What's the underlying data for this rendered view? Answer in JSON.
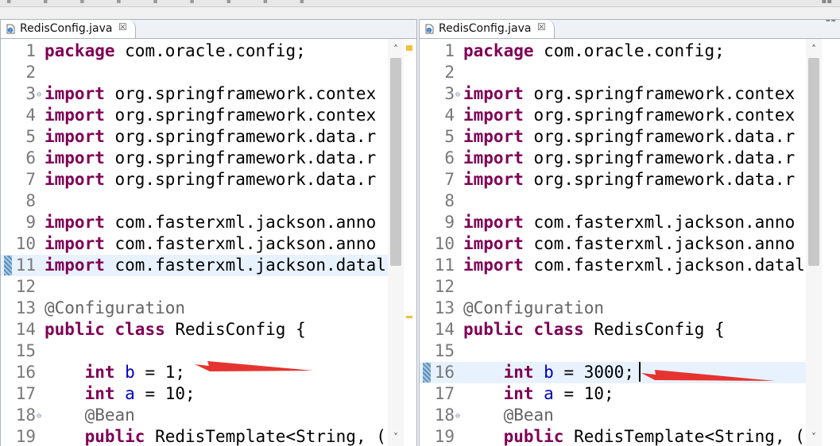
{
  "editors": [
    {
      "tab": {
        "label": "RedisConfig.java",
        "close_glyph": "☒"
      },
      "lines": [
        {
          "n": "1",
          "parts": [
            {
              "t": "package",
              "k": "kw"
            },
            {
              "t": " com.oracle.config;"
            }
          ]
        },
        {
          "n": "2",
          "parts": []
        },
        {
          "n": "3",
          "fold": true,
          "parts": [
            {
              "t": "import",
              "k": "kw"
            },
            {
              "t": " org.springframework.contex"
            }
          ]
        },
        {
          "n": "4",
          "parts": [
            {
              "t": "import",
              "k": "kw"
            },
            {
              "t": " org.springframework.contex"
            }
          ]
        },
        {
          "n": "5",
          "parts": [
            {
              "t": "import",
              "k": "kw"
            },
            {
              "t": " org.springframework.data.r"
            }
          ]
        },
        {
          "n": "6",
          "parts": [
            {
              "t": "import",
              "k": "kw"
            },
            {
              "t": " org.springframework.data.r"
            }
          ]
        },
        {
          "n": "7",
          "parts": [
            {
              "t": "import",
              "k": "kw"
            },
            {
              "t": " org.springframework.data.r"
            }
          ]
        },
        {
          "n": "8",
          "parts": []
        },
        {
          "n": "9",
          "parts": [
            {
              "t": "import",
              "k": "kw"
            },
            {
              "t": " com.fasterxml.jackson.anno"
            }
          ]
        },
        {
          "n": "10",
          "parts": [
            {
              "t": "import",
              "k": "kw"
            },
            {
              "t": " com.fasterxml.jackson.anno"
            }
          ]
        },
        {
          "n": "11",
          "hl": true,
          "marker": true,
          "parts": [
            {
              "t": "import",
              "k": "kw"
            },
            {
              "t": " com.fasterxml.jackson.datal"
            }
          ]
        },
        {
          "n": "12",
          "parts": []
        },
        {
          "n": "13",
          "parts": [
            {
              "t": "@Configuration",
              "k": "ann"
            }
          ]
        },
        {
          "n": "14",
          "parts": [
            {
              "t": "public",
              "k": "kw"
            },
            {
              "t": " "
            },
            {
              "t": "class",
              "k": "kw"
            },
            {
              "t": " RedisConfig {"
            }
          ]
        },
        {
          "n": "15",
          "parts": []
        },
        {
          "n": "16",
          "parts": [
            {
              "t": "    "
            },
            {
              "t": "int",
              "k": "kw"
            },
            {
              "t": " "
            },
            {
              "t": "b",
              "k": "fld"
            },
            {
              "t": " = 1;"
            }
          ]
        },
        {
          "n": "17",
          "parts": [
            {
              "t": "    "
            },
            {
              "t": "int",
              "k": "kw"
            },
            {
              "t": " "
            },
            {
              "t": "a",
              "k": "fld"
            },
            {
              "t": " = 10;"
            }
          ]
        },
        {
          "n": "18",
          "fold": true,
          "parts": [
            {
              "t": "    "
            },
            {
              "t": "@Bean",
              "k": "ann"
            }
          ]
        },
        {
          "n": "19",
          "parts": [
            {
              "t": "    "
            },
            {
              "t": "public",
              "k": "kw"
            },
            {
              "t": " RedisTemplate<String, ("
            }
          ]
        }
      ]
    },
    {
      "tab": {
        "label": "RedisConfig.java",
        "close_glyph": "☒"
      },
      "lines": [
        {
          "n": "1",
          "parts": [
            {
              "t": "package",
              "k": "kw"
            },
            {
              "t": " com.oracle.config;"
            }
          ]
        },
        {
          "n": "2",
          "parts": []
        },
        {
          "n": "3",
          "fold": true,
          "parts": [
            {
              "t": "import",
              "k": "kw"
            },
            {
              "t": " org.springframework.contex"
            }
          ]
        },
        {
          "n": "4",
          "parts": [
            {
              "t": "import",
              "k": "kw"
            },
            {
              "t": " org.springframework.contex"
            }
          ]
        },
        {
          "n": "5",
          "parts": [
            {
              "t": "import",
              "k": "kw"
            },
            {
              "t": " org.springframework.data.r"
            }
          ]
        },
        {
          "n": "6",
          "parts": [
            {
              "t": "import",
              "k": "kw"
            },
            {
              "t": " org.springframework.data.r"
            }
          ]
        },
        {
          "n": "7",
          "parts": [
            {
              "t": "import",
              "k": "kw"
            },
            {
              "t": " org.springframework.data.r"
            }
          ]
        },
        {
          "n": "8",
          "parts": []
        },
        {
          "n": "9",
          "parts": [
            {
              "t": "import",
              "k": "kw"
            },
            {
              "t": " com.fasterxml.jackson.anno"
            }
          ]
        },
        {
          "n": "10",
          "parts": [
            {
              "t": "import",
              "k": "kw"
            },
            {
              "t": " com.fasterxml.jackson.anno"
            }
          ]
        },
        {
          "n": "11",
          "parts": [
            {
              "t": "import",
              "k": "kw"
            },
            {
              "t": " com.fasterxml.jackson.datal"
            }
          ]
        },
        {
          "n": "12",
          "parts": []
        },
        {
          "n": "13",
          "parts": [
            {
              "t": "@Configuration",
              "k": "ann"
            }
          ]
        },
        {
          "n": "14",
          "parts": [
            {
              "t": "public",
              "k": "kw"
            },
            {
              "t": " "
            },
            {
              "t": "class",
              "k": "kw"
            },
            {
              "t": " RedisConfig {"
            }
          ]
        },
        {
          "n": "15",
          "parts": []
        },
        {
          "n": "16",
          "hl": true,
          "marker": true,
          "parts": [
            {
              "t": "    "
            },
            {
              "t": "int",
              "k": "kw"
            },
            {
              "t": " "
            },
            {
              "t": "b",
              "k": "fld"
            },
            {
              "t": " = 3000;"
            }
          ]
        },
        {
          "n": "17",
          "parts": [
            {
              "t": "    "
            },
            {
              "t": "int",
              "k": "kw"
            },
            {
              "t": " "
            },
            {
              "t": "a",
              "k": "fld"
            },
            {
              "t": " = 10;"
            }
          ]
        },
        {
          "n": "18",
          "fold": true,
          "parts": [
            {
              "t": "    "
            },
            {
              "t": "@Bean",
              "k": "ann"
            }
          ]
        },
        {
          "n": "19",
          "parts": [
            {
              "t": "    "
            },
            {
              "t": "public",
              "k": "kw"
            },
            {
              "t": " RedisTemplate<String, ("
            }
          ]
        }
      ]
    }
  ],
  "colors": {
    "keyword": "#7f0055",
    "annotation": "#646464",
    "field": "#0000c0",
    "line_number": "#787878",
    "current_line": "#e8f2fe",
    "arrow": "#e5342f"
  },
  "icons": {
    "tab_file": "java-file-icon",
    "tab_close": "close-icon",
    "fold": "fold-collapse-icon",
    "scroll_up": "scroll-up-arrow-icon",
    "scroll_down": "scroll-down-arrow-icon",
    "annotation_pointer": "red-arrow-icon"
  },
  "glyphs": {
    "fold": "⊖",
    "scroll_up": "˄",
    "scroll_down": "˅"
  }
}
